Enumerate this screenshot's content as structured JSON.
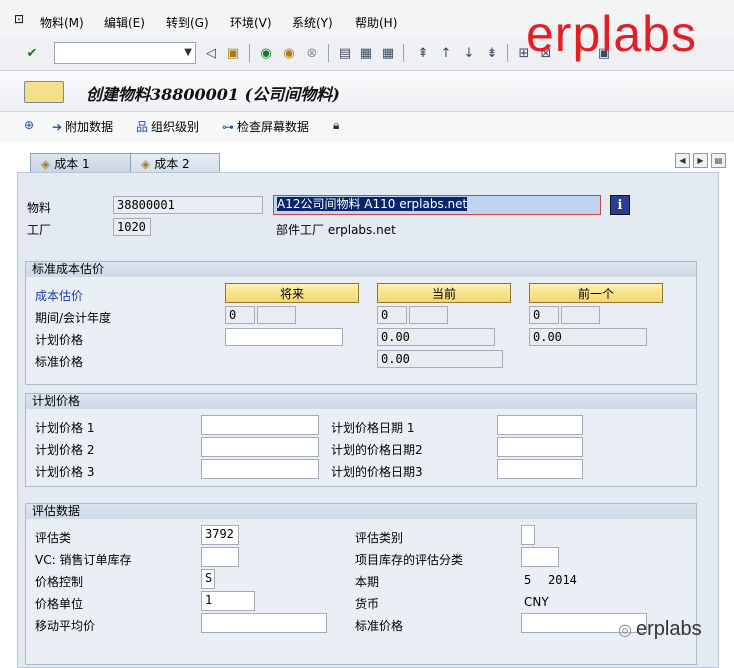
{
  "menubar": {
    "items": [
      "物料(M)",
      "编辑(E)",
      "转到(G)",
      "环境(V)",
      "系统(Y)",
      "帮助(H)"
    ]
  },
  "watermark": "erplabs",
  "watermark_bottom": "erplabs",
  "title": "创建物料38800001 (公司间物料)",
  "app_toolbar": {
    "additional_data": "附加数据",
    "org_levels": "组织级别",
    "check_screen_data": "检查屏幕数据"
  },
  "tabs": [
    {
      "label": "成本 1",
      "active": false
    },
    {
      "label": "成本 2",
      "active": true
    }
  ],
  "header": {
    "material_label": "物料",
    "material_value": "38800001",
    "material_desc": "A12公司间物料 A110 erplabs.net",
    "plant_label": "工厂",
    "plant_value": "1020",
    "plant_desc": "部件工厂 erplabs.net"
  },
  "std_cost": {
    "title": "标准成本估价",
    "cost_estimate_label": "成本估价",
    "col_future": "将来",
    "col_current": "当前",
    "col_previous": "前一个",
    "period_label": "期间/会计年度",
    "future_period": "0",
    "current_period": "0",
    "previous_period": "0",
    "planned_price_label": "计划价格",
    "current_planned_price": "0.00",
    "previous_planned_price": "0.00",
    "standard_price_label": "标准价格",
    "current_standard_price": "0.00"
  },
  "planned_prices": {
    "title": "计划价格",
    "p1_label": "计划价格 1",
    "p2_label": "计划价格 2",
    "p3_label": "计划价格 3",
    "d1_label": "计划价格日期 1",
    "d2_label": "计划的价格日期2",
    "d3_label": "计划的价格日期3"
  },
  "valuation": {
    "title": "评估数据",
    "valuation_class_label": "评估类",
    "valuation_class_value": "3792",
    "vc_sales_label": "VC: 销售订单库存",
    "price_control_label": "价格控制",
    "price_control_value": "S",
    "price_unit_label": "价格单位",
    "price_unit_value": "1",
    "moving_avg_label": "移动平均价",
    "valuation_category_label": "评估类别",
    "project_stock_label": "项目库存的评估分类",
    "current_period_label": "本期",
    "current_period_month": "5",
    "current_period_year": "2014",
    "currency_label": "货币",
    "currency_value": "CNY",
    "standard_price_label": "标准价格"
  }
}
